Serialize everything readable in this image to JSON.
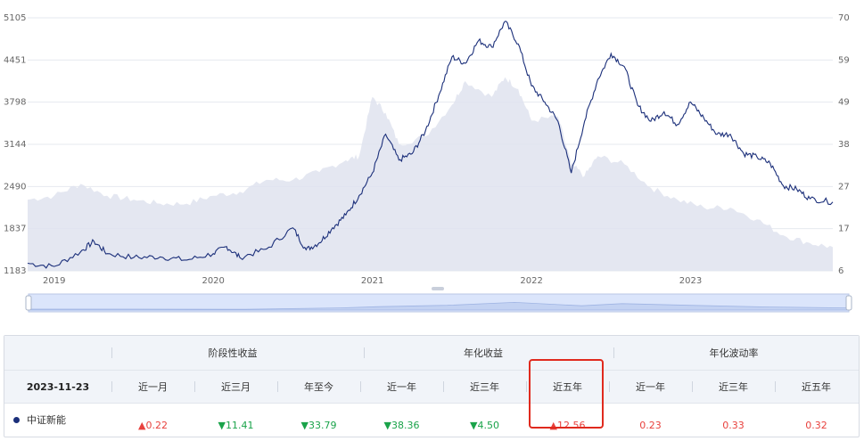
{
  "chart_data": {
    "type": "line",
    "left_axis": {
      "ticks": [
        "5105",
        "4451",
        "3798",
        "3144",
        "2490",
        "1837",
        "1183"
      ],
      "range": [
        1183,
        5105
      ]
    },
    "right_axis": {
      "ticks": [
        "70",
        "59",
        "49",
        "38",
        "27",
        "17",
        "6"
      ],
      "range": [
        6,
        70
      ]
    },
    "x_ticks": [
      "2019",
      "2020",
      "2021",
      "2022",
      "2023"
    ],
    "x_range": [
      "2018-11",
      "2023-11"
    ],
    "series": [
      {
        "style": "line",
        "color": "#1b2f7a",
        "axis": "left",
        "points": [
          [
            "2018-11",
            1300
          ],
          [
            "2019-01",
            1250
          ],
          [
            "2019-03",
            1480
          ],
          [
            "2019-04",
            1640
          ],
          [
            "2019-05",
            1450
          ],
          [
            "2019-07",
            1390
          ],
          [
            "2019-09",
            1400
          ],
          [
            "2019-11",
            1350
          ],
          [
            "2020-01",
            1450
          ],
          [
            "2020-02",
            1560
          ],
          [
            "2020-03",
            1390
          ],
          [
            "2020-05",
            1520
          ],
          [
            "2020-07",
            1850
          ],
          [
            "2020-08",
            1510
          ],
          [
            "2020-09",
            1620
          ],
          [
            "2020-10",
            1850
          ],
          [
            "2020-11",
            2050
          ],
          [
            "2020-12",
            2350
          ],
          [
            "2021-01",
            2700
          ],
          [
            "2021-02",
            3300
          ],
          [
            "2021-03",
            2900
          ],
          [
            "2021-04",
            3000
          ],
          [
            "2021-05",
            3350
          ],
          [
            "2021-06",
            3900
          ],
          [
            "2021-07",
            4500
          ],
          [
            "2021-08",
            4400
          ],
          [
            "2021-09",
            4750
          ],
          [
            "2021-10",
            4650
          ],
          [
            "2021-11",
            5050
          ],
          [
            "2021-12",
            4700
          ],
          [
            "2022-01",
            4050
          ],
          [
            "2022-02",
            3800
          ],
          [
            "2022-03",
            3500
          ],
          [
            "2022-04",
            2700
          ],
          [
            "2022-05",
            3500
          ],
          [
            "2022-06",
            4150
          ],
          [
            "2022-07",
            4550
          ],
          [
            "2022-08",
            4350
          ],
          [
            "2022-09",
            3750
          ],
          [
            "2022-10",
            3500
          ],
          [
            "2022-11",
            3650
          ],
          [
            "2022-12",
            3450
          ],
          [
            "2023-01",
            3800
          ],
          [
            "2023-02",
            3550
          ],
          [
            "2023-03",
            3300
          ],
          [
            "2023-04",
            3300
          ],
          [
            "2023-05",
            3000
          ],
          [
            "2023-06",
            2950
          ],
          [
            "2023-07",
            2850
          ],
          [
            "2023-08",
            2500
          ],
          [
            "2023-09",
            2450
          ],
          [
            "2023-10",
            2300
          ],
          [
            "2023-11-23",
            2250
          ]
        ]
      },
      {
        "style": "area",
        "color": "#dfe3ef",
        "axis": "right",
        "points": [
          [
            "2018-11",
            24
          ],
          [
            "2019-01",
            25
          ],
          [
            "2019-03",
            28
          ],
          [
            "2019-05",
            25
          ],
          [
            "2019-07",
            24
          ],
          [
            "2019-09",
            23
          ],
          [
            "2019-11",
            23
          ],
          [
            "2020-01",
            25
          ],
          [
            "2020-03",
            26
          ],
          [
            "2020-05",
            29
          ],
          [
            "2020-07",
            29
          ],
          [
            "2020-09",
            31
          ],
          [
            "2020-11",
            34
          ],
          [
            "2020-12",
            35
          ],
          [
            "2021-01",
            50
          ],
          [
            "2021-02",
            46
          ],
          [
            "2021-03",
            38
          ],
          [
            "2021-05",
            40
          ],
          [
            "2021-07",
            48
          ],
          [
            "2021-08",
            54
          ],
          [
            "2021-10",
            50
          ],
          [
            "2021-11",
            55
          ],
          [
            "2021-12",
            52
          ],
          [
            "2022-01",
            44
          ],
          [
            "2022-03",
            45
          ],
          [
            "2022-04",
            33
          ],
          [
            "2022-05",
            30
          ],
          [
            "2022-06",
            35
          ],
          [
            "2022-08",
            33
          ],
          [
            "2022-10",
            27
          ],
          [
            "2022-12",
            24
          ],
          [
            "2023-02",
            22
          ],
          [
            "2023-04",
            22
          ],
          [
            "2023-06",
            19
          ],
          [
            "2023-08",
            15
          ],
          [
            "2023-10",
            13
          ],
          [
            "2023-11-23",
            12
          ]
        ]
      }
    ],
    "navigator_points": [
      [
        "2018-11",
        0.1
      ],
      [
        "2019-07",
        0.1
      ],
      [
        "2020-03",
        0.08
      ],
      [
        "2020-10",
        0.25
      ],
      [
        "2021-01",
        0.4
      ],
      [
        "2021-06",
        0.55
      ],
      [
        "2021-11",
        0.9
      ],
      [
        "2022-04",
        0.5
      ],
      [
        "2022-07",
        0.75
      ],
      [
        "2022-12",
        0.55
      ],
      [
        "2023-06",
        0.35
      ],
      [
        "2023-11-23",
        0.25
      ]
    ]
  },
  "table": {
    "groups": [
      "阶段性收益",
      "年化收益",
      "年化波动率"
    ],
    "date": "2023-11-23",
    "columns": [
      "近一月",
      "近三月",
      "年至今",
      "近一年",
      "近三年",
      "近五年",
      "近一年",
      "近三年",
      "近五年"
    ],
    "row": {
      "name": "中证新能",
      "marker_color": "#1b2f7a",
      "values": [
        {
          "text": "▲0.22",
          "dir": "up"
        },
        {
          "text": "▼11.41",
          "dir": "down"
        },
        {
          "text": "▼33.79",
          "dir": "down"
        },
        {
          "text": "▼38.36",
          "dir": "down"
        },
        {
          "text": "▼4.50",
          "dir": "down"
        },
        {
          "text": "▲12.56",
          "dir": "up"
        },
        {
          "text": "0.23",
          "dir": "up"
        },
        {
          "text": "0.33",
          "dir": "up"
        },
        {
          "text": "0.32",
          "dir": "up"
        }
      ]
    }
  },
  "colors": {
    "up": "#e8413d",
    "down": "#1aa34a",
    "highlight": "#e02a1e",
    "line": "#1b2f7a"
  }
}
